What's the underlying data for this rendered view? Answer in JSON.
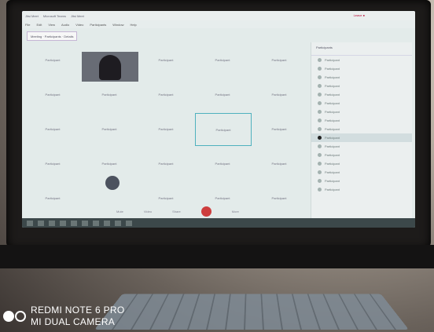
{
  "window": {
    "tabs": [
      "Jitsi Meet",
      "Microsoft Teams",
      "Jitsi Meet"
    ],
    "menu": [
      "File",
      "Edit",
      "View",
      "Audio",
      "Video",
      "Participants",
      "Window",
      "Help"
    ],
    "status_badge": "Leave ●",
    "meeting_button": "Meeting · Participants · Details"
  },
  "grid_labels": [
    "Participant",
    "",
    "Participant",
    "Participant",
    "Participant",
    "Participant",
    "Participant",
    "Participant",
    "Participant",
    "Participant",
    "Participant",
    "Participant",
    "Participant",
    "Participant",
    "Participant",
    "Participant",
    "Participant",
    "Participant",
    "Participant",
    "Participant",
    "Participant",
    "",
    "Participant",
    "Participant",
    "Participant"
  ],
  "panel": {
    "header": "Participants",
    "items": [
      "Participant",
      "Participant",
      "Participant",
      "Participant",
      "Participant",
      "Participant",
      "Participant",
      "Participant",
      "Participant",
      "Participant",
      "Participant",
      "Participant",
      "Participant",
      "Participant",
      "Participant",
      "Participant"
    ]
  },
  "controls": [
    "Mute",
    "Video",
    "Share",
    "More"
  ],
  "watermark": {
    "line1": "REDMI NOTE 6 PRO",
    "line2": "MI DUAL CAMERA"
  },
  "colors": {
    "hangup": "#e03b3b",
    "active_tile": "#49b9c8"
  }
}
